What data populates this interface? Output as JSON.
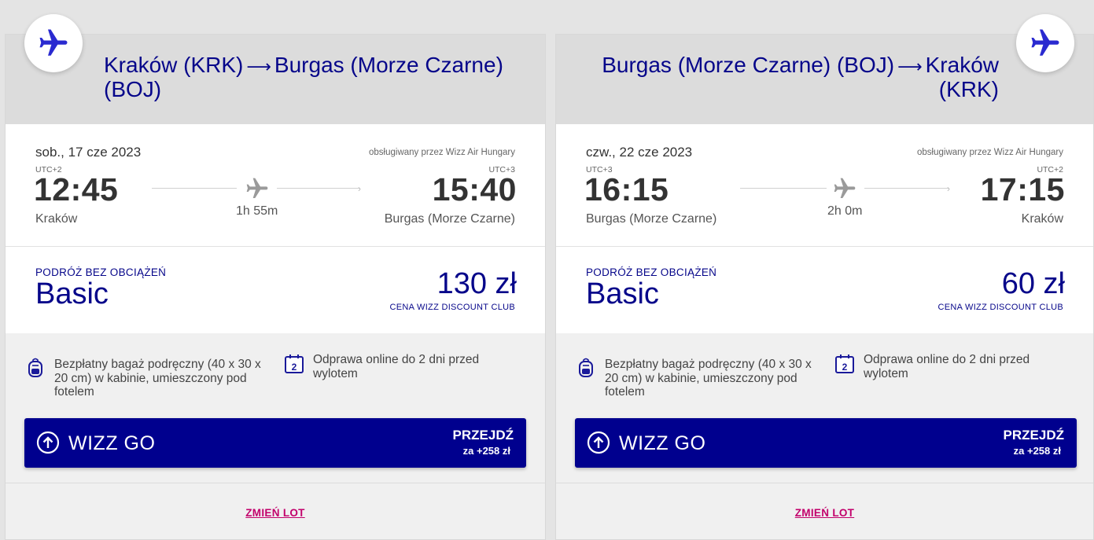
{
  "colors": {
    "brand": "#06068a",
    "button": "#00008e",
    "link": "#c2006b"
  },
  "flights": [
    {
      "route_from": "Kraków (KRK)",
      "route_to": "Burgas (Morze Czarne) (BOJ)",
      "date": "sob., 17 cze 2023",
      "operated_by": "obsługiwany przez Wizz Air Hungary",
      "dep_utc": "UTC+2",
      "arr_utc": "UTC+3",
      "dep_time": "12:45",
      "arr_time": "15:40",
      "dep_city": "Kraków",
      "arr_city": "Burgas (Morze Czarne)",
      "duration": "1h 55m",
      "fare_subtitle": "PODRÓŻ BEZ OBCIĄŻEŃ",
      "fare_name": "Basic",
      "price": "130 zł",
      "price_note": "CENA WIZZ DISCOUNT CLUB",
      "perk_baggage": "Bezpłatny bagaż podręczny (40 x 30 x 20 cm) w kabinie, umieszczony pod fotelem",
      "perk_checkin": "Odprawa online do 2 dni przed wylotem",
      "checkin_icon_text": "2",
      "upsell_label": "WIZZ GO",
      "upsell_action": "PRZEJDŹ",
      "upsell_price": "za +258 zł",
      "change_link": "ZMIEŃ LOT"
    },
    {
      "route_from": "Burgas (Morze Czarne) (BOJ)",
      "route_to": "Kraków (KRK)",
      "date": "czw., 22 cze 2023",
      "operated_by": "obsługiwany przez Wizz Air Hungary",
      "dep_utc": "UTC+3",
      "arr_utc": "UTC+2",
      "dep_time": "16:15",
      "arr_time": "17:15",
      "dep_city": "Burgas (Morze Czarne)",
      "arr_city": "Kraków",
      "duration": "2h 0m",
      "fare_subtitle": "PODRÓŻ BEZ OBCIĄŻEŃ",
      "fare_name": "Basic",
      "price": "60 zł",
      "price_note": "CENA WIZZ DISCOUNT CLUB",
      "perk_baggage": "Bezpłatny bagaż podręczny (40 x 30 x 20 cm) w kabinie, umieszczony pod fotelem",
      "perk_checkin": "Odprawa online do 2 dni przed wylotem",
      "checkin_icon_text": "2",
      "upsell_label": "WIZZ GO",
      "upsell_action": "PRZEJDŹ",
      "upsell_price": "za +258 zł",
      "change_link": "ZMIEŃ LOT"
    }
  ],
  "icons": [
    "plane-icon",
    "backpack-icon",
    "calendar-icon",
    "arrow-up-circle-icon"
  ]
}
